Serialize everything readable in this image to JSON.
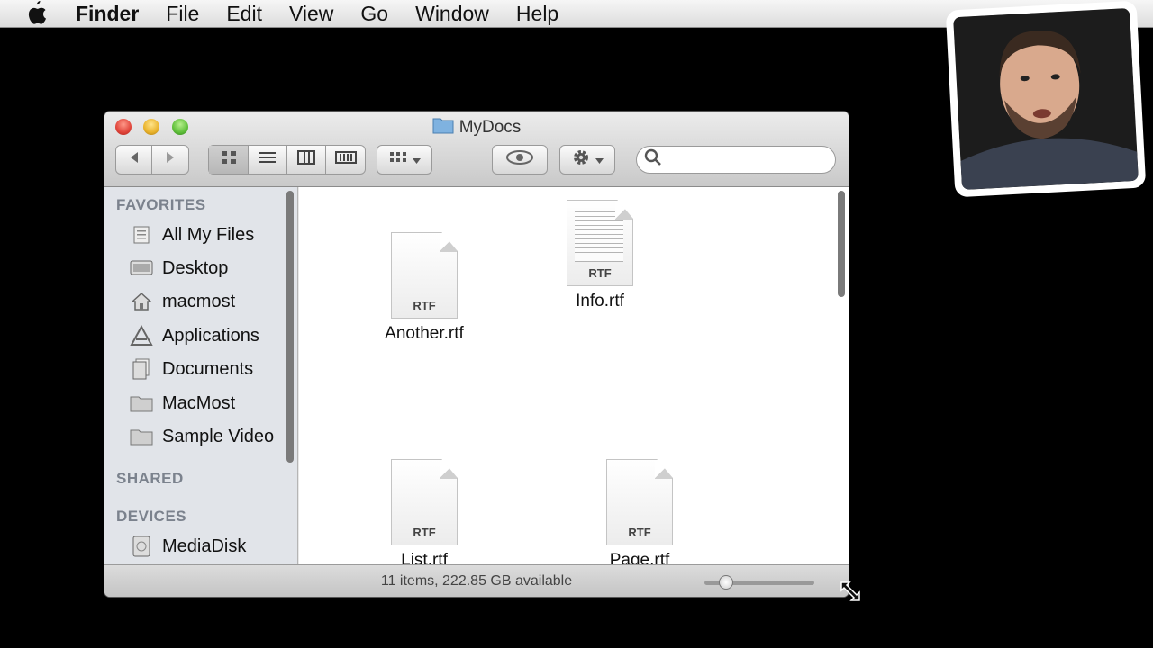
{
  "menubar": {
    "items": [
      "Finder",
      "File",
      "Edit",
      "View",
      "Go",
      "Window",
      "Help"
    ]
  },
  "window": {
    "title": "MyDocs",
    "search": {
      "placeholder": "",
      "value": ""
    }
  },
  "sidebar": {
    "favorites_heading": "FAVORITES",
    "favorites": [
      {
        "label": "All My Files",
        "icon": "all-my-files-icon"
      },
      {
        "label": "Desktop",
        "icon": "desktop-icon"
      },
      {
        "label": "macmost",
        "icon": "home-icon"
      },
      {
        "label": "Applications",
        "icon": "applications-icon"
      },
      {
        "label": "Documents",
        "icon": "documents-icon"
      },
      {
        "label": "MacMost",
        "icon": "folder-icon"
      },
      {
        "label": "Sample Video",
        "icon": "folder-icon"
      }
    ],
    "shared_heading": "SHARED",
    "devices_heading": "DEVICES",
    "devices": [
      {
        "label": "MediaDisk",
        "icon": "disk-icon"
      }
    ]
  },
  "files": [
    {
      "name": "Another.rtf",
      "type": "RTF"
    },
    {
      "name": "Info.rtf",
      "type": "RTF"
    },
    {
      "name": "List.rtf",
      "type": "RTF"
    },
    {
      "name": "Page.rtf",
      "type": "RTF"
    }
  ],
  "status": {
    "text": "11 items, 222.85 GB available",
    "icon_size": 0.2
  },
  "colors": {
    "sidebar_bg": "#e1e4e9",
    "heading": "#7b828d",
    "folder_blue": "#7fb2e0"
  }
}
